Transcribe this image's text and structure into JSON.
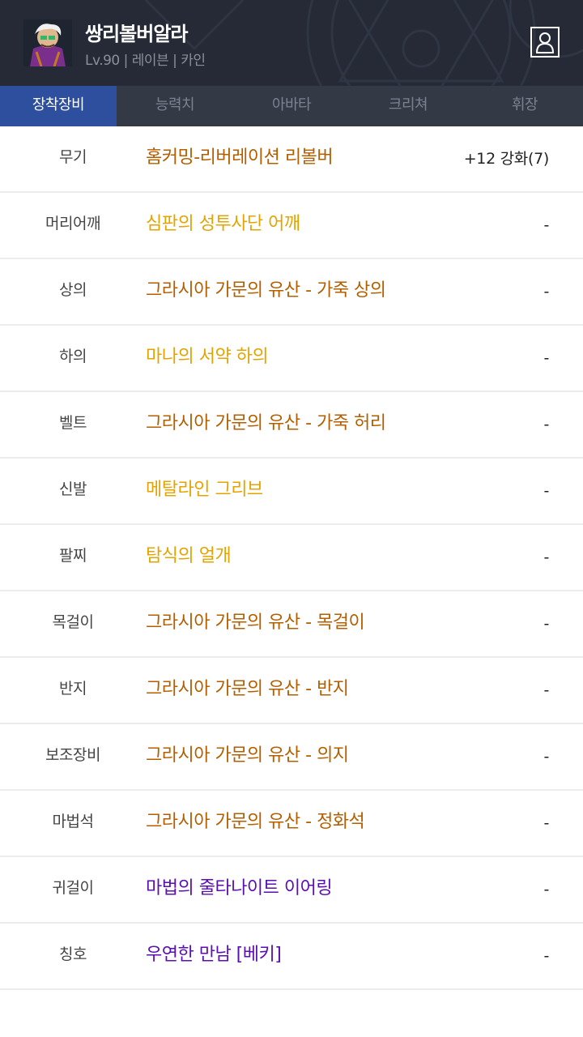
{
  "character": {
    "name": "쌍리볼버알라",
    "info": "Lv.90 | 레이븐 | 카인"
  },
  "icons": {
    "avatar": "character-avatar",
    "profile": "person-outline-icon"
  },
  "colors": {
    "header_bg": "#252a36",
    "tab_bg": "#333a46",
    "tab_active": "#2d4f9e",
    "rarity_unique": "#b35f00",
    "rarity_rare": "#e3a400",
    "rarity_epic": "#5a0fb0"
  },
  "tabs": [
    {
      "label": "장착장비",
      "active": true
    },
    {
      "label": "능력치",
      "active": false
    },
    {
      "label": "아바타",
      "active": false
    },
    {
      "label": "크리쳐",
      "active": false
    },
    {
      "label": "휘장",
      "active": false
    }
  ],
  "equipment": [
    {
      "slot": "무기",
      "item": "홈커밍-리버레이션 리볼버",
      "enhance": "+12 강화(7)",
      "color": "#b35f00"
    },
    {
      "slot": "머리어깨",
      "item": "심판의 성투사단 어깨",
      "enhance": "-",
      "color": "#e3a400"
    },
    {
      "slot": "상의",
      "item": "그라시아 가문의 유산 - 가죽 상의",
      "enhance": "-",
      "color": "#b35f00"
    },
    {
      "slot": "하의",
      "item": "마나의 서약 하의",
      "enhance": "-",
      "color": "#e3a400"
    },
    {
      "slot": "벨트",
      "item": "그라시아 가문의 유산 - 가죽 허리",
      "enhance": "-",
      "color": "#b35f00"
    },
    {
      "slot": "신발",
      "item": "메탈라인 그리브",
      "enhance": "-",
      "color": "#e3a400"
    },
    {
      "slot": "팔찌",
      "item": "탐식의 얼개",
      "enhance": "-",
      "color": "#e3a400"
    },
    {
      "slot": "목걸이",
      "item": "그라시아 가문의 유산 - 목걸이",
      "enhance": "-",
      "color": "#b35f00"
    },
    {
      "slot": "반지",
      "item": "그라시아 가문의 유산 - 반지",
      "enhance": "-",
      "color": "#b35f00"
    },
    {
      "slot": "보조장비",
      "item": "그라시아 가문의 유산 - 의지",
      "enhance": "-",
      "color": "#b35f00"
    },
    {
      "slot": "마법석",
      "item": "그라시아 가문의 유산 - 정화석",
      "enhance": "-",
      "color": "#b35f00"
    },
    {
      "slot": "귀걸이",
      "item": "마법의 줄타나이트 이어링",
      "enhance": "-",
      "color": "#5a0fb0"
    },
    {
      "slot": "칭호",
      "item": "우연한 만남 [베키]",
      "enhance": "-",
      "color": "#5a0fb0"
    }
  ]
}
